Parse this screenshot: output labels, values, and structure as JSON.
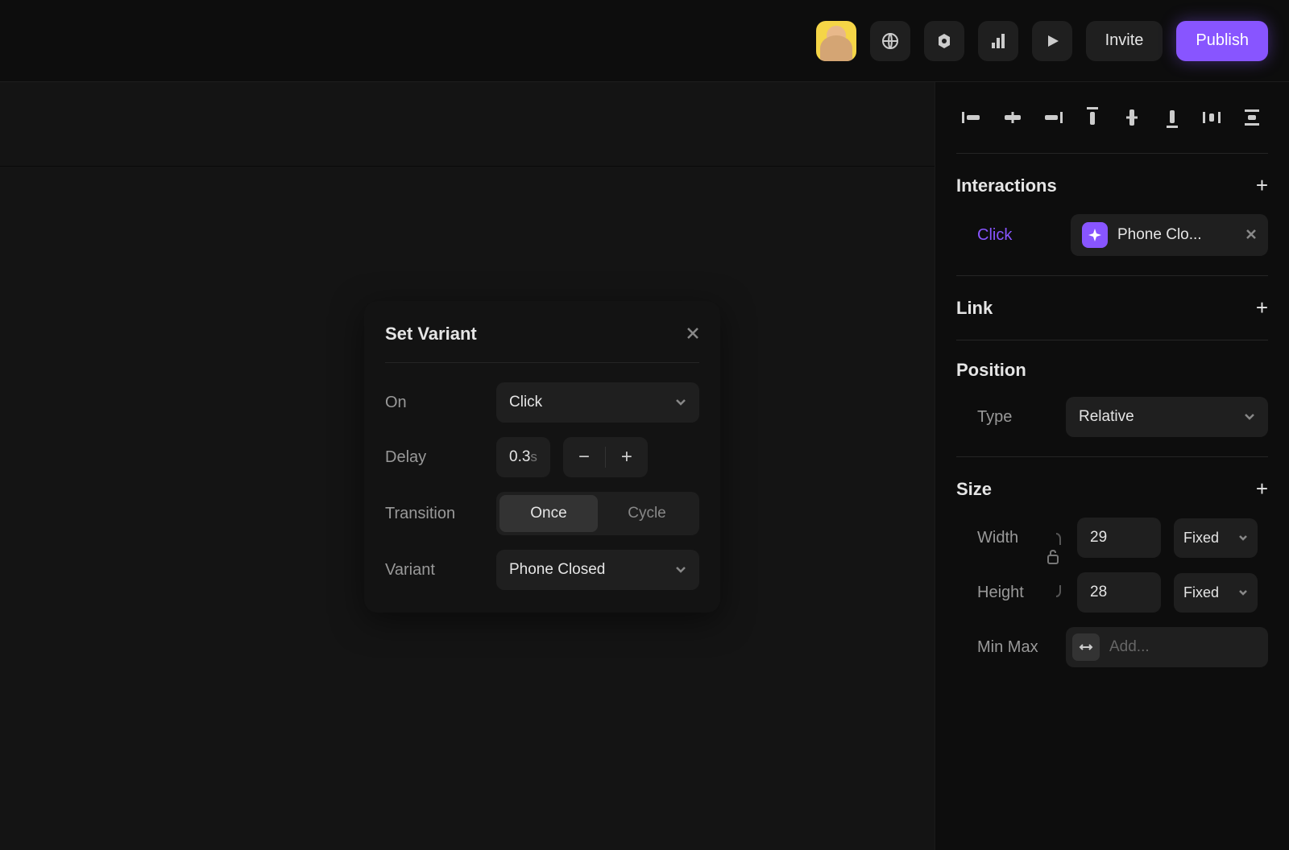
{
  "header": {
    "invite_label": "Invite",
    "publish_label": "Publish"
  },
  "popup": {
    "title": "Set Variant",
    "on": {
      "label": "On",
      "value": "Click"
    },
    "delay": {
      "label": "Delay",
      "value": "0.3",
      "unit": "s"
    },
    "transition": {
      "label": "Transition",
      "options": [
        "Once",
        "Cycle"
      ],
      "active": "Once"
    },
    "variant": {
      "label": "Variant",
      "value": "Phone Closed"
    }
  },
  "sidebar": {
    "interactions": {
      "title": "Interactions",
      "trigger": "Click",
      "action": "Phone Clo..."
    },
    "link": {
      "title": "Link"
    },
    "position": {
      "title": "Position",
      "type_label": "Type",
      "type_value": "Relative"
    },
    "size": {
      "title": "Size",
      "width_label": "Width",
      "width_value": "29",
      "width_unit": "Fixed",
      "height_label": "Height",
      "height_value": "28",
      "height_unit": "Fixed",
      "minmax_label": "Min Max",
      "minmax_placeholder": "Add..."
    }
  }
}
